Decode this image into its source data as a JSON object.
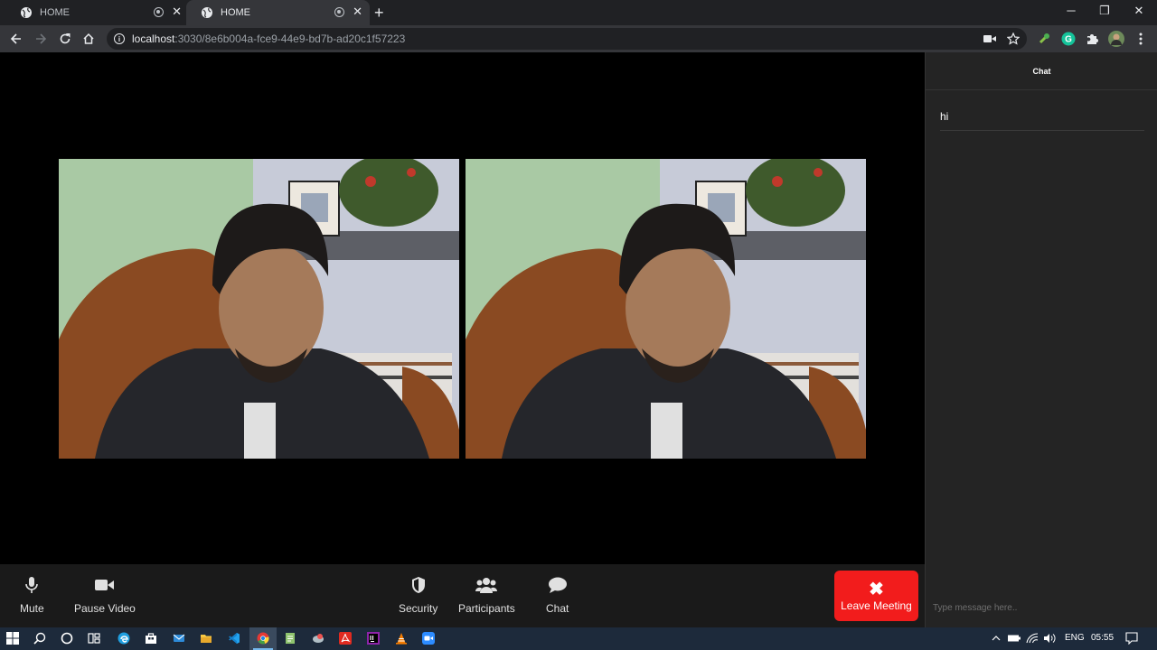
{
  "browser": {
    "tabs": [
      {
        "title": "HOME",
        "active": false
      },
      {
        "title": "HOME",
        "active": true
      }
    ],
    "url_host": "localhost",
    "url_path": ":3030/8e6b004a-fce9-44e9-bd7b-ad20c1f57223"
  },
  "meeting": {
    "controls": {
      "mute": "Mute",
      "pause_video": "Pause Video",
      "security": "Security",
      "participants": "Participants",
      "chat": "Chat",
      "leave": "Leave Meeting"
    }
  },
  "chat": {
    "title": "Chat",
    "messages": [
      "hi"
    ],
    "placeholder": "Type message here.."
  },
  "taskbar": {
    "language": "ENG",
    "time": "05:55"
  },
  "colors": {
    "leave_button": "#f21c1c",
    "chat_bg": "#242424",
    "controls_bg": "#1a1a1a",
    "taskbar_bg": "#1d2a3b"
  }
}
